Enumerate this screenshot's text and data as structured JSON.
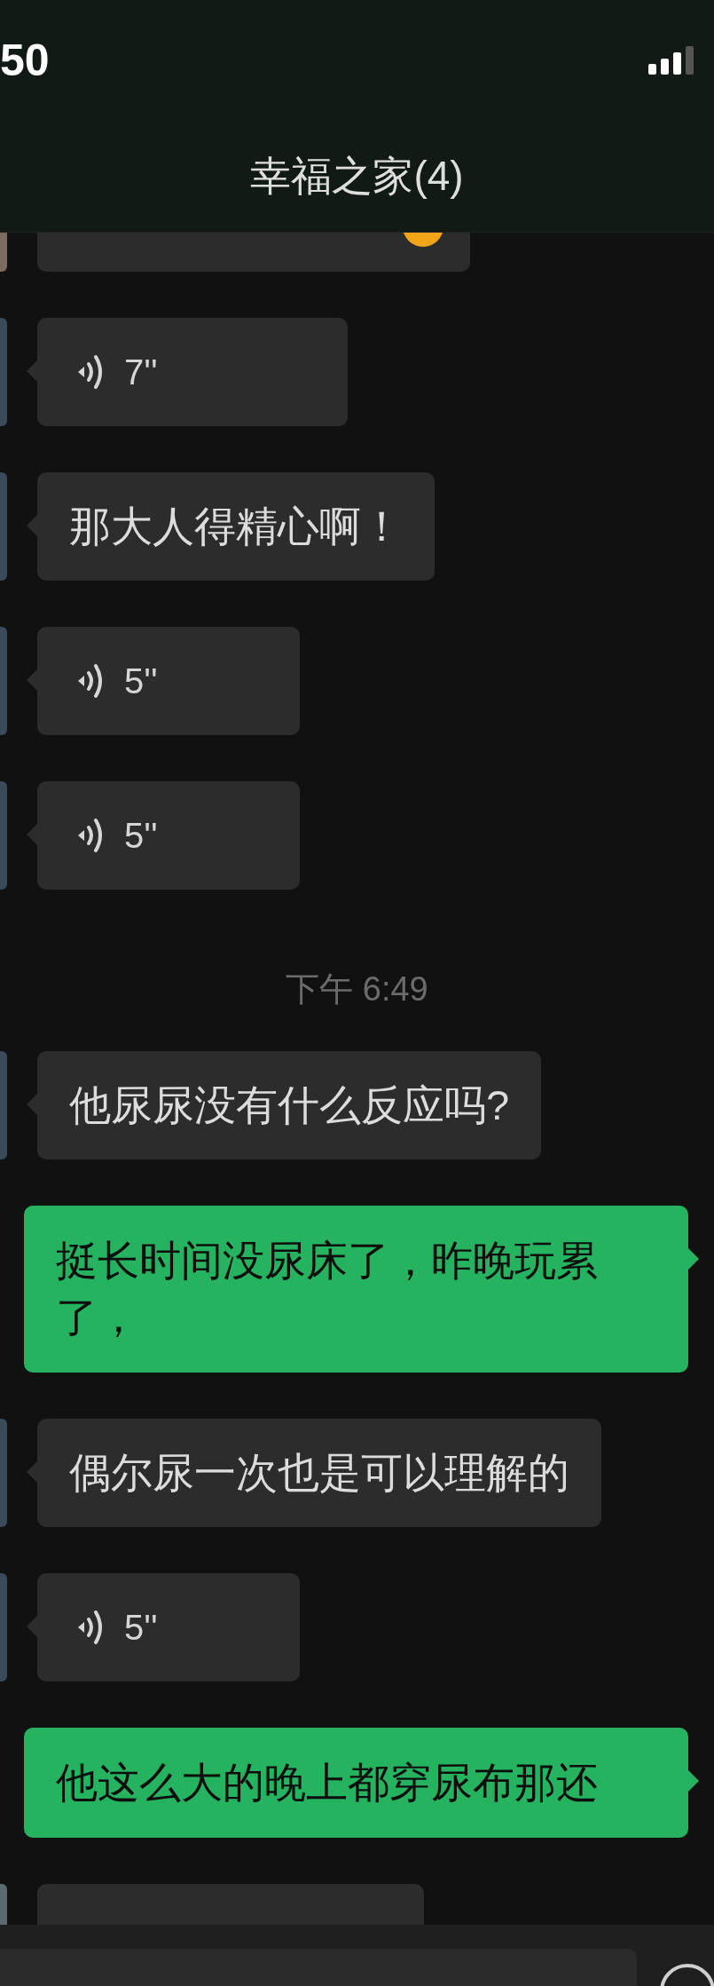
{
  "status_bar": {
    "time": "50"
  },
  "header": {
    "title": "幸福之家(4)"
  },
  "messages": [
    {
      "kind": "partial"
    },
    {
      "kind": "voice",
      "duration": "7''"
    },
    {
      "kind": "text",
      "text": "那大人得精心啊！"
    },
    {
      "kind": "voice",
      "duration": "5''"
    },
    {
      "kind": "voice",
      "duration": "5''"
    },
    {
      "kind": "time",
      "text": "下午 6:49"
    },
    {
      "kind": "text",
      "text": "他尿尿没有什么反应吗?"
    },
    {
      "kind": "sent",
      "text": "挺长时间没尿床了，昨晚玩累了，"
    },
    {
      "kind": "text",
      "text": "偶尔尿一次也是可以理解的"
    },
    {
      "kind": "voice",
      "duration": "5''"
    },
    {
      "kind": "sent",
      "text": "他这么大的晚上都穿尿布那还"
    },
    {
      "kind": "partial_bottom"
    }
  ]
}
